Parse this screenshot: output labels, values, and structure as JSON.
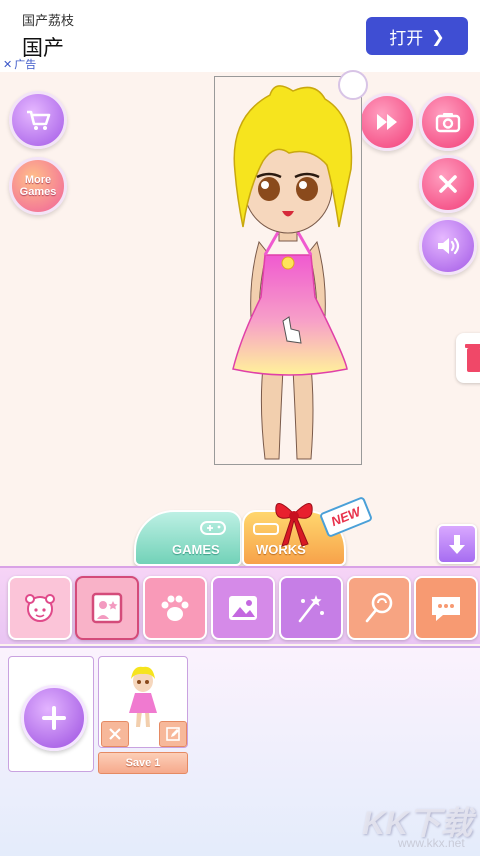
{
  "ad": {
    "title": "国产荔枝",
    "subtitle": "国产",
    "open_button": "打开",
    "tag": "广告",
    "close_mark": "✕"
  },
  "left_buttons": {
    "shop_icon": "shopping-cart-icon",
    "more_games_line1": "More",
    "more_games_line2": "Games"
  },
  "right_buttons": {
    "icons": [
      "fast-forward-icon",
      "camera-icon",
      "close-icon",
      "speaker-icon"
    ]
  },
  "tabs": {
    "games_label": "GAMES",
    "works_label": "WORKS",
    "new_badge": "NEW"
  },
  "categories": {
    "items": [
      {
        "icon": "girl-face-icon",
        "color": "#f9b2c8"
      },
      {
        "icon": "photo-frame-icon",
        "color": "#f9b2c8"
      },
      {
        "icon": "paw-icon",
        "color": "#f99ab8"
      },
      {
        "icon": "picture-icon",
        "color": "#d58ae8"
      },
      {
        "icon": "sparkle-wand-icon",
        "color": "#c67ee6"
      },
      {
        "icon": "lollipop-icon",
        "color": "#f7a482"
      },
      {
        "icon": "chat-bubble-icon",
        "color": "#f79a72"
      }
    ]
  },
  "saves": {
    "slot1_label": "Save 1"
  },
  "watermark": {
    "text": "KK下载",
    "url": "www.kkx.net"
  }
}
